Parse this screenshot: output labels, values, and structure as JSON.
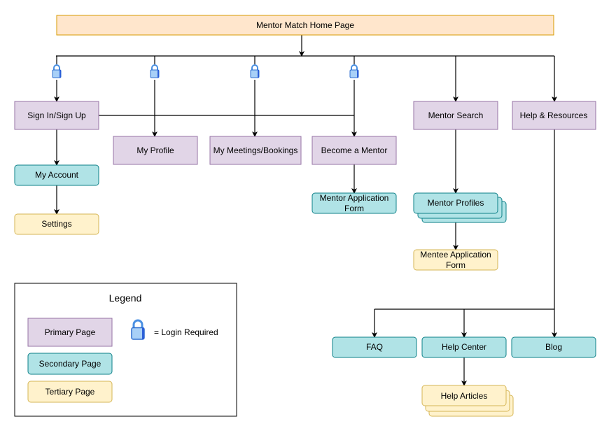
{
  "nodes": {
    "home": "Mentor Match Home Page",
    "sign_in": "Sign In/Sign Up",
    "my_profile": "My Profile",
    "my_meetings": "My Meetings/Bookings",
    "become_mentor": "Become a Mentor",
    "mentor_search": "Mentor Search",
    "help_resources": "Help & Resources",
    "my_account": "My Account",
    "settings": "Settings",
    "mentor_app_form_1": "Mentor Application",
    "mentor_app_form_2": "Form",
    "mentor_profiles": "Mentor Profiles",
    "mentee_app_form_1": "Mentee Application",
    "mentee_app_form_2": "Form",
    "faq": "FAQ",
    "help_center": "Help Center",
    "blog": "Blog",
    "help_articles": "Help Articles"
  },
  "legend": {
    "title": "Legend",
    "primary": "Primary Page",
    "secondary": "Secondary Page",
    "tertiary": "Tertiary Page",
    "login": "=  Login Required"
  },
  "colors": {
    "home": "#ffe6cc",
    "primary": "#e1d5e7",
    "secondary": "#b0e3e6",
    "tertiary": "#fff2cc"
  },
  "icons": {
    "login_required": "lock-icon"
  }
}
